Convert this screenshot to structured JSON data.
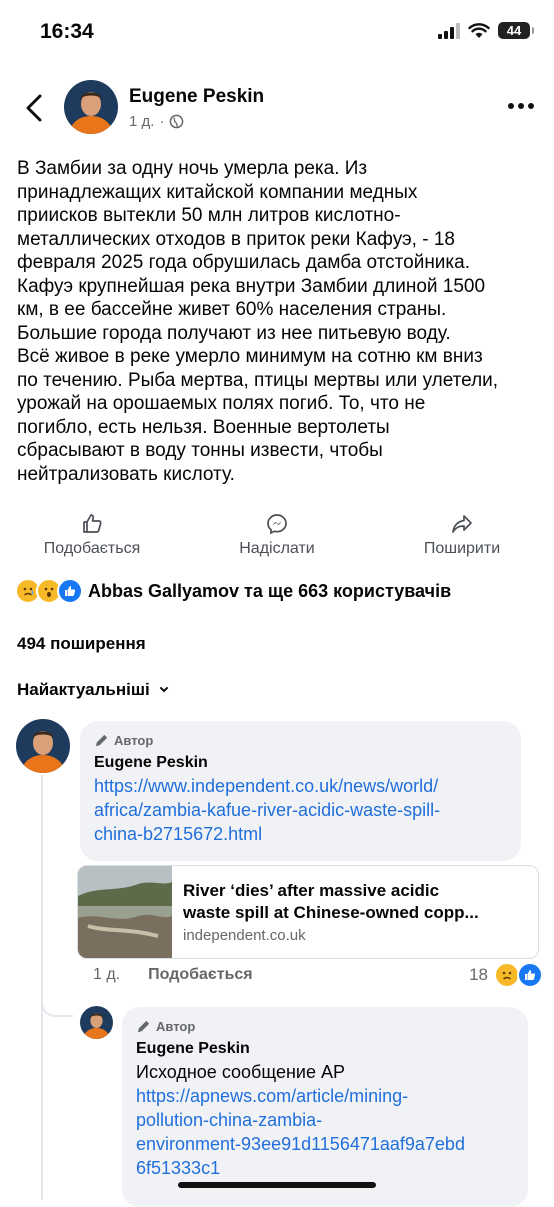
{
  "status_bar": {
    "time": "16:34",
    "battery": "44"
  },
  "post": {
    "author": "Eugene Peskin",
    "time_ago": "1 д.",
    "separator": "·",
    "text": "В Замбии за одну ночь  умерла река. Из\nпринадлежащих китайской компании медных\nприисков вытекли 50 млн литров кислотно-\nметаллических отходов в приток реки Кафуэ,  - 18\nфевраля 2025 года обрушилась дамба отстойника.\nКафуэ крупнейшая река внутри Замбии длиной 1500\nкм,  в ее бассейне живет 60% населения страны.\nБольшие города получают из нее питьевую воду.\nВсё живое в реке умерло минимум на сотню км вниз\nпо течению. Рыба мертва, птицы мертвы или улетели,\nурожай на орошаемых полях погиб. То, что не\nпогибло, есть нельзя. Военные вертолеты\nсбрасывают в воду тонны извести, чтобы\nнейтрализовать кислоту."
  },
  "actions": {
    "like": "Подобається",
    "send": "Надіслати",
    "share": "Поширити"
  },
  "reactions": {
    "text": "Abbas Gallyamov та ще 663 користувачів",
    "icons": [
      "sad",
      "wow",
      "like"
    ]
  },
  "shares_count": "494 поширення",
  "sort_label": "Найактуальніші",
  "comments": [
    {
      "badge": "Автор",
      "author": "Eugene Peskin",
      "link_lines": [
        "https://www.independent.co.uk/news/world/",
        "africa/zambia-kafue-river-acidic-waste-spill-",
        "china-b2715672.html"
      ],
      "card": {
        "title_lines": [
          "River ‘dies’ after massive acidic",
          "waste spill at Chinese-owned copp..."
        ],
        "domain": "independent.co.uk"
      },
      "time_ago": "1 д.",
      "like_label": "Подобається",
      "reaction_count": "18"
    },
    {
      "badge": "Автор",
      "author": "Eugene Peskin",
      "text": "Исходное сообщение AP",
      "link_lines": [
        "https://apnews.com/article/mining-",
        "pollution-china-zambia-",
        "environment-93ee91d1156471aaf9a7ebd",
        "6f51333c1"
      ]
    }
  ],
  "colors": {
    "link": "#216fdb",
    "meta": "#65676b",
    "bubble": "#f0f2f5",
    "avatar_bg": "#e8751a",
    "like_blue": "#1877f2",
    "sad_yellow": "#f7b928"
  }
}
